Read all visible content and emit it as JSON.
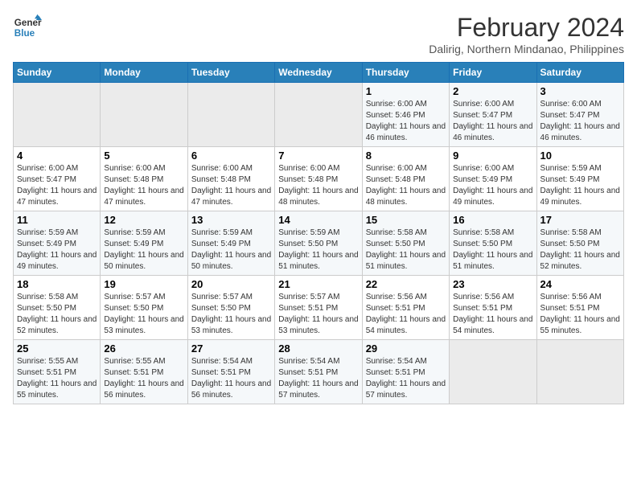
{
  "logo": {
    "line1": "General",
    "line2": "Blue"
  },
  "title": "February 2024",
  "subtitle": "Dalirig, Northern Mindanao, Philippines",
  "days_header": [
    "Sunday",
    "Monday",
    "Tuesday",
    "Wednesday",
    "Thursday",
    "Friday",
    "Saturday"
  ],
  "weeks": [
    [
      {
        "day": "",
        "sunrise": "",
        "sunset": "",
        "daylight": ""
      },
      {
        "day": "",
        "sunrise": "",
        "sunset": "",
        "daylight": ""
      },
      {
        "day": "",
        "sunrise": "",
        "sunset": "",
        "daylight": ""
      },
      {
        "day": "",
        "sunrise": "",
        "sunset": "",
        "daylight": ""
      },
      {
        "day": "1",
        "sunrise": "Sunrise: 6:00 AM",
        "sunset": "Sunset: 5:46 PM",
        "daylight": "Daylight: 11 hours and 46 minutes."
      },
      {
        "day": "2",
        "sunrise": "Sunrise: 6:00 AM",
        "sunset": "Sunset: 5:47 PM",
        "daylight": "Daylight: 11 hours and 46 minutes."
      },
      {
        "day": "3",
        "sunrise": "Sunrise: 6:00 AM",
        "sunset": "Sunset: 5:47 PM",
        "daylight": "Daylight: 11 hours and 46 minutes."
      }
    ],
    [
      {
        "day": "4",
        "sunrise": "Sunrise: 6:00 AM",
        "sunset": "Sunset: 5:47 PM",
        "daylight": "Daylight: 11 hours and 47 minutes."
      },
      {
        "day": "5",
        "sunrise": "Sunrise: 6:00 AM",
        "sunset": "Sunset: 5:48 PM",
        "daylight": "Daylight: 11 hours and 47 minutes."
      },
      {
        "day": "6",
        "sunrise": "Sunrise: 6:00 AM",
        "sunset": "Sunset: 5:48 PM",
        "daylight": "Daylight: 11 hours and 47 minutes."
      },
      {
        "day": "7",
        "sunrise": "Sunrise: 6:00 AM",
        "sunset": "Sunset: 5:48 PM",
        "daylight": "Daylight: 11 hours and 48 minutes."
      },
      {
        "day": "8",
        "sunrise": "Sunrise: 6:00 AM",
        "sunset": "Sunset: 5:48 PM",
        "daylight": "Daylight: 11 hours and 48 minutes."
      },
      {
        "day": "9",
        "sunrise": "Sunrise: 6:00 AM",
        "sunset": "Sunset: 5:49 PM",
        "daylight": "Daylight: 11 hours and 49 minutes."
      },
      {
        "day": "10",
        "sunrise": "Sunrise: 5:59 AM",
        "sunset": "Sunset: 5:49 PM",
        "daylight": "Daylight: 11 hours and 49 minutes."
      }
    ],
    [
      {
        "day": "11",
        "sunrise": "Sunrise: 5:59 AM",
        "sunset": "Sunset: 5:49 PM",
        "daylight": "Daylight: 11 hours and 49 minutes."
      },
      {
        "day": "12",
        "sunrise": "Sunrise: 5:59 AM",
        "sunset": "Sunset: 5:49 PM",
        "daylight": "Daylight: 11 hours and 50 minutes."
      },
      {
        "day": "13",
        "sunrise": "Sunrise: 5:59 AM",
        "sunset": "Sunset: 5:49 PM",
        "daylight": "Daylight: 11 hours and 50 minutes."
      },
      {
        "day": "14",
        "sunrise": "Sunrise: 5:59 AM",
        "sunset": "Sunset: 5:50 PM",
        "daylight": "Daylight: 11 hours and 51 minutes."
      },
      {
        "day": "15",
        "sunrise": "Sunrise: 5:58 AM",
        "sunset": "Sunset: 5:50 PM",
        "daylight": "Daylight: 11 hours and 51 minutes."
      },
      {
        "day": "16",
        "sunrise": "Sunrise: 5:58 AM",
        "sunset": "Sunset: 5:50 PM",
        "daylight": "Daylight: 11 hours and 51 minutes."
      },
      {
        "day": "17",
        "sunrise": "Sunrise: 5:58 AM",
        "sunset": "Sunset: 5:50 PM",
        "daylight": "Daylight: 11 hours and 52 minutes."
      }
    ],
    [
      {
        "day": "18",
        "sunrise": "Sunrise: 5:58 AM",
        "sunset": "Sunset: 5:50 PM",
        "daylight": "Daylight: 11 hours and 52 minutes."
      },
      {
        "day": "19",
        "sunrise": "Sunrise: 5:57 AM",
        "sunset": "Sunset: 5:50 PM",
        "daylight": "Daylight: 11 hours and 53 minutes."
      },
      {
        "day": "20",
        "sunrise": "Sunrise: 5:57 AM",
        "sunset": "Sunset: 5:50 PM",
        "daylight": "Daylight: 11 hours and 53 minutes."
      },
      {
        "day": "21",
        "sunrise": "Sunrise: 5:57 AM",
        "sunset": "Sunset: 5:51 PM",
        "daylight": "Daylight: 11 hours and 53 minutes."
      },
      {
        "day": "22",
        "sunrise": "Sunrise: 5:56 AM",
        "sunset": "Sunset: 5:51 PM",
        "daylight": "Daylight: 11 hours and 54 minutes."
      },
      {
        "day": "23",
        "sunrise": "Sunrise: 5:56 AM",
        "sunset": "Sunset: 5:51 PM",
        "daylight": "Daylight: 11 hours and 54 minutes."
      },
      {
        "day": "24",
        "sunrise": "Sunrise: 5:56 AM",
        "sunset": "Sunset: 5:51 PM",
        "daylight": "Daylight: 11 hours and 55 minutes."
      }
    ],
    [
      {
        "day": "25",
        "sunrise": "Sunrise: 5:55 AM",
        "sunset": "Sunset: 5:51 PM",
        "daylight": "Daylight: 11 hours and 55 minutes."
      },
      {
        "day": "26",
        "sunrise": "Sunrise: 5:55 AM",
        "sunset": "Sunset: 5:51 PM",
        "daylight": "Daylight: 11 hours and 56 minutes."
      },
      {
        "day": "27",
        "sunrise": "Sunrise: 5:54 AM",
        "sunset": "Sunset: 5:51 PM",
        "daylight": "Daylight: 11 hours and 56 minutes."
      },
      {
        "day": "28",
        "sunrise": "Sunrise: 5:54 AM",
        "sunset": "Sunset: 5:51 PM",
        "daylight": "Daylight: 11 hours and 57 minutes."
      },
      {
        "day": "29",
        "sunrise": "Sunrise: 5:54 AM",
        "sunset": "Sunset: 5:51 PM",
        "daylight": "Daylight: 11 hours and 57 minutes."
      },
      {
        "day": "",
        "sunrise": "",
        "sunset": "",
        "daylight": ""
      },
      {
        "day": "",
        "sunrise": "",
        "sunset": "",
        "daylight": ""
      }
    ]
  ]
}
